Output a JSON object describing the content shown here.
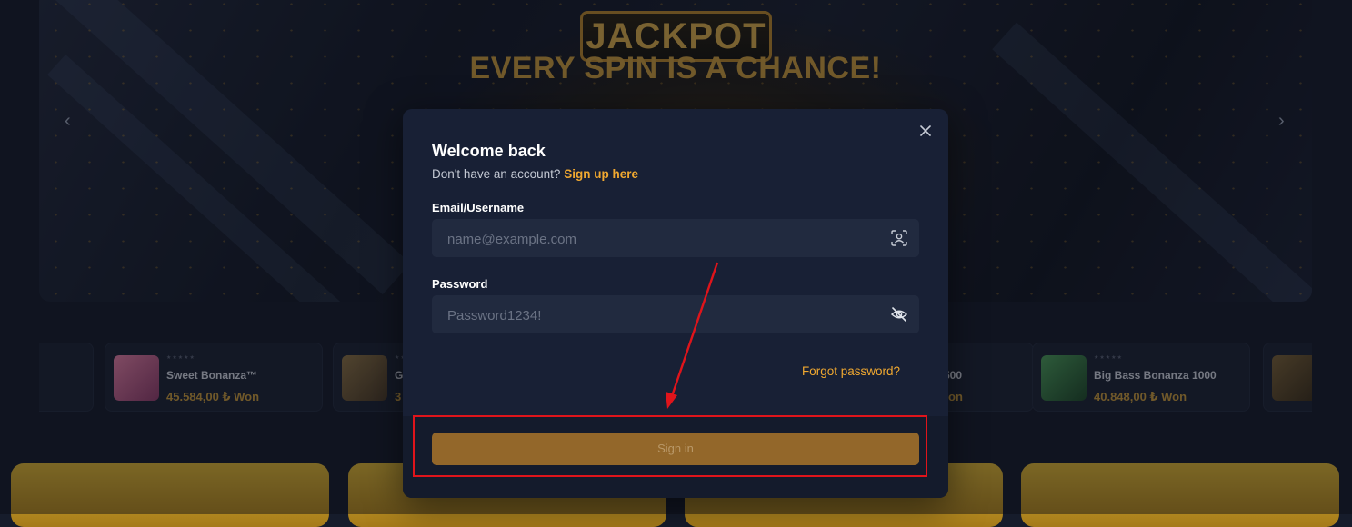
{
  "hero": {
    "title": "JACKPOT",
    "subtitle": "EVERY SPIN IS A CHANCE!",
    "prev_icon": "chevron-left-icon",
    "next_icon": "chevron-right-icon",
    "prev_glyph": "‹",
    "next_glyph": "›"
  },
  "games": [
    {
      "name": "",
      "amount": "",
      "thumb_color": "#3a2f25"
    },
    {
      "name": "Sweet Bonanza™",
      "amount": "45.584,00 ₺ Won",
      "thumb_color": "#c6577c"
    },
    {
      "name": "G",
      "amount": "3",
      "thumb_color": "#6b5a3a"
    },
    {
      "name": "500",
      "amount": "on",
      "thumb_color": "#5a4a3a"
    },
    {
      "name": "Big Bass Bonanza 1000",
      "amount": "40.848,00 ₺ Won",
      "thumb_color": "#2f6a3c"
    },
    {
      "name": "",
      "amount": "",
      "thumb_color": "#5a4c30"
    }
  ],
  "modal": {
    "title": "Welcome back",
    "signup_prompt": "Don't have an account?",
    "signup_link": "Sign up here",
    "email_label": "Email/Username",
    "email_placeholder": "name@example.com",
    "email_icon": "face-scan-icon",
    "password_label": "Password",
    "password_placeholder": "Password1234!",
    "password_icon": "eye-off-icon",
    "forgot_password": "Forgot password?",
    "signin_button": "Sign in",
    "close_icon": "close-icon"
  },
  "colors": {
    "accent": "#f0a830",
    "signin_button_bg": "#93672a",
    "modal_bg": "#182035",
    "input_bg": "#212a3f",
    "annotation_red": "#e0141b"
  }
}
